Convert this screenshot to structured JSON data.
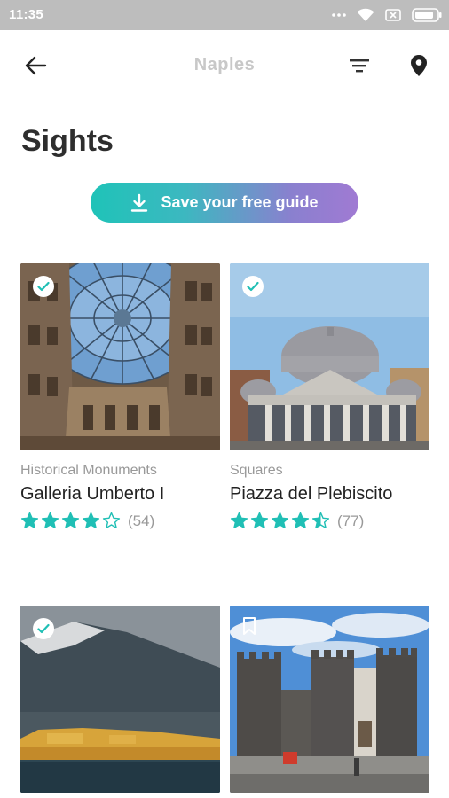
{
  "status_bar": {
    "time": "11:35",
    "icons": [
      "dots-icon",
      "wifi-icon",
      "sim-icon",
      "battery-icon"
    ]
  },
  "header": {
    "title": "Naples",
    "back_icon": "arrow-left-icon",
    "filter_icon": "filter-icon",
    "map_icon": "location-pin-icon"
  },
  "page": {
    "title": "Sights"
  },
  "save_guide": {
    "label": "Save your free guide",
    "icon": "download-icon"
  },
  "colors": {
    "accent_teal": "#1fc3b8",
    "accent_purple": "#a07ad3",
    "star": "#20bfb5"
  },
  "cards": [
    {
      "category": "Historical Monuments",
      "name": "Galleria Umberto I",
      "rating": 4,
      "reviews": "(54)",
      "saved": true,
      "badge_icon": "check-icon"
    },
    {
      "category": "Squares",
      "name": "Piazza del Plebiscito",
      "rating": 4.5,
      "reviews": "(77)",
      "saved": true,
      "badge_icon": "check-icon"
    },
    {
      "saved": true,
      "badge_icon": "check-icon"
    },
    {
      "saved": false,
      "badge_icon": "bookmark-icon"
    }
  ]
}
